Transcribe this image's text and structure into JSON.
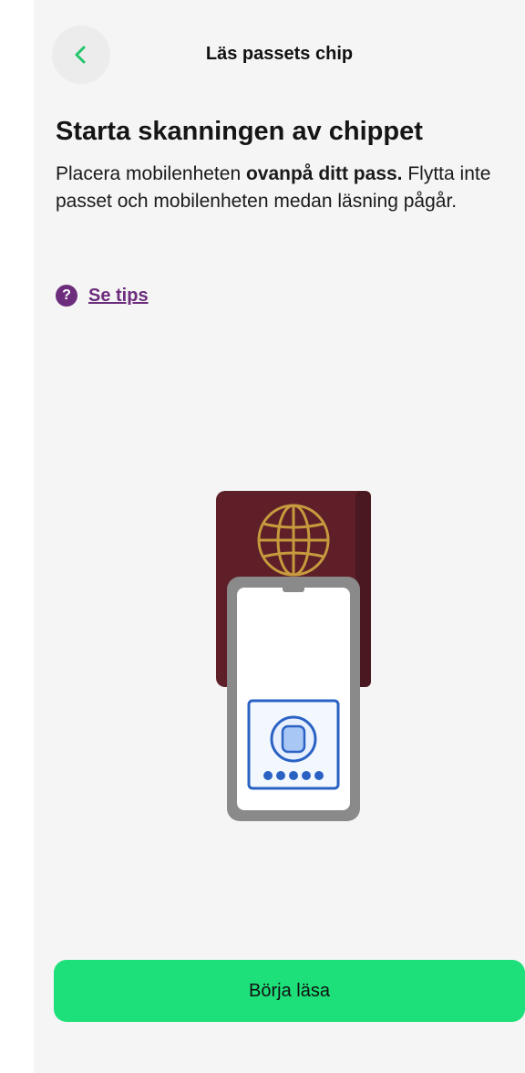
{
  "header": {
    "title": "Läs passets chip",
    "back_icon": "chevron-left-icon"
  },
  "content": {
    "heading": "Starta skanningen av chippet",
    "body_pre": "Placera mobilenheten ",
    "body_bold": "ovanpå ditt pass.",
    "body_post": " Flytta inte passet och mobilenheten medan läsning pågår."
  },
  "tips": {
    "icon_label": "?",
    "label": "Se tips"
  },
  "illustration": {
    "icon": "phone-on-passport-illustration"
  },
  "cta": {
    "label": "Börja läsa"
  },
  "colors": {
    "accent_green": "#1ee07a",
    "tips_purple": "#6c2d7d",
    "passport_burgundy": "#5e1f28"
  }
}
